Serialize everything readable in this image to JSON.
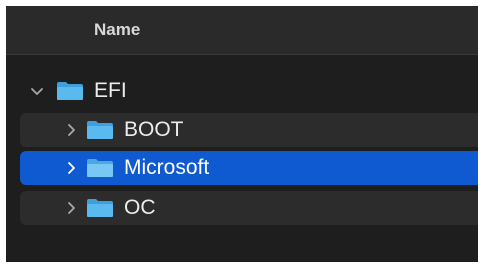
{
  "header": {
    "name_column": "Name"
  },
  "tree": {
    "root": {
      "label": "EFI",
      "expanded": true,
      "icon": "folder-icon"
    },
    "children": [
      {
        "label": "BOOT",
        "expanded": false,
        "selected": false,
        "icon": "folder-icon"
      },
      {
        "label": "Microsoft",
        "expanded": false,
        "selected": true,
        "icon": "folder-icon"
      },
      {
        "label": "OC",
        "expanded": false,
        "selected": false,
        "icon": "folder-icon"
      }
    ]
  },
  "colors": {
    "selection": "#0f59d1",
    "folder": "#4fb2e9",
    "background": "#1e1e1e",
    "alt_row": "#2c2c2c"
  }
}
